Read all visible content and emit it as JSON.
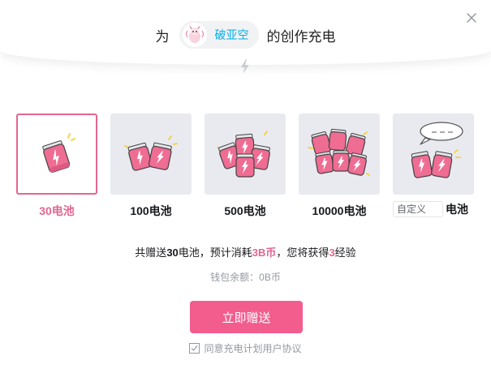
{
  "header": {
    "prefix": "为",
    "up_name": "破亚空",
    "suffix": "的创作充电"
  },
  "icons": {
    "close": "close-icon",
    "bolt": "lightning-icon",
    "battery": "battery-icon",
    "avatar": "avatar"
  },
  "colors": {
    "accent": "#e3668f",
    "button": "#f25d8e",
    "card_bg": "#e9eaf0",
    "link": "#00aeec"
  },
  "options": [
    {
      "label": "30电池",
      "selected": true
    },
    {
      "label": "100电池",
      "selected": false
    },
    {
      "label": "500电池",
      "selected": false
    },
    {
      "label": "10000电池",
      "selected": false
    }
  ],
  "custom": {
    "placeholder": "自定义",
    "unit": "电池"
  },
  "summary": {
    "part1": "共赠送",
    "battery_count": "30",
    "part2": "电池，预计消耗",
    "b_coins": "3B币",
    "part3": "，您将获得",
    "exp": "3",
    "part4": "经验"
  },
  "wallet": "钱包余额：0B币",
  "confirm_label": "立即赠送",
  "agreement": {
    "checked": true,
    "text": "同意充电计划用户协议"
  }
}
